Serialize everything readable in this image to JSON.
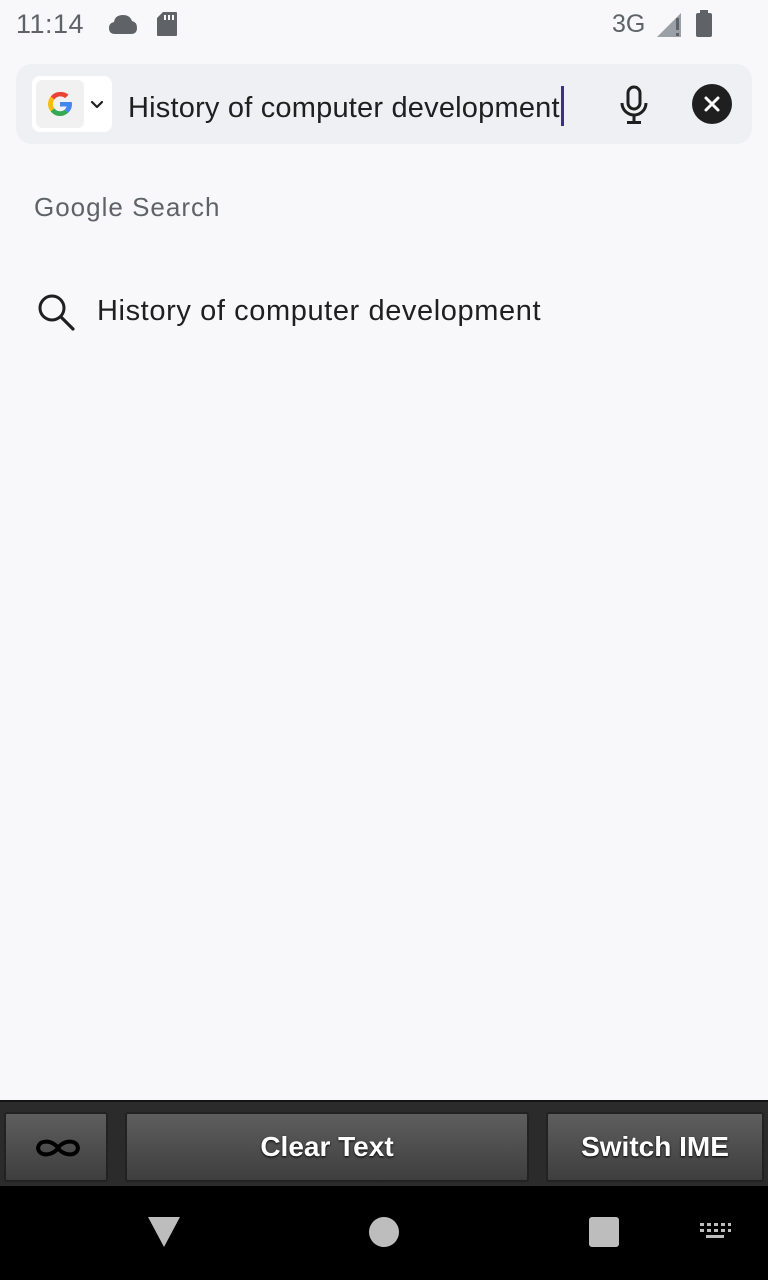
{
  "status_bar": {
    "time": "11:14",
    "network": "3G",
    "icons": [
      "cloud-icon",
      "sd-card-icon",
      "signal-icon",
      "battery-icon"
    ]
  },
  "search_bar": {
    "engine_icon": "google-logo",
    "query": "History of computer development",
    "mic_icon": "microphone-icon",
    "clear_icon": "close-icon"
  },
  "section": {
    "label": "Google Search"
  },
  "suggestions": [
    {
      "icon": "search-icon",
      "text": "History of computer development"
    }
  ],
  "ime_bar": {
    "infinity_icon": "infinity-icon",
    "clear_text_label": "Clear Text",
    "switch_ime_label": "Switch IME"
  },
  "nav_bar": {
    "icons": [
      "back-icon",
      "home-icon",
      "recents-icon",
      "keyboard-icon"
    ]
  },
  "colors": {
    "background": "#f8f8fb",
    "search_bar_bg": "#eff0f4",
    "caret": "#3b2f87",
    "text_primary": "#1f1f1f",
    "text_secondary": "#5f6368"
  }
}
